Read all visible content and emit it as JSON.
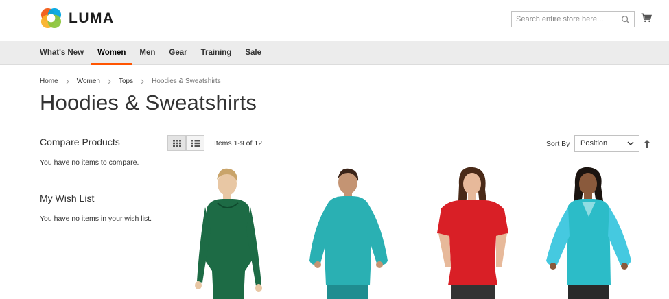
{
  "header": {
    "brand": "LUMA",
    "search_placeholder": "Search entire store here...",
    "logo_colors": [
      "#f26322",
      "#f9b22a",
      "#8dc63f",
      "#00a6e2"
    ]
  },
  "nav": {
    "items": [
      {
        "label": "What's New",
        "active": false
      },
      {
        "label": "Women",
        "active": true
      },
      {
        "label": "Men",
        "active": false
      },
      {
        "label": "Gear",
        "active": false
      },
      {
        "label": "Training",
        "active": false
      },
      {
        "label": "Sale",
        "active": false
      }
    ],
    "active_color": "#ff5501"
  },
  "breadcrumb": [
    "Home",
    "Women",
    "Tops",
    "Hoodies & Sweatshirts"
  ],
  "page_title": "Hoodies & Sweatshirts",
  "sidebar": {
    "compare_title": "Compare Products",
    "compare_text": "You have no items to compare.",
    "wishlist_title": "My Wish List",
    "wishlist_text": "You have no items in your wish list."
  },
  "toolbar": {
    "items_count": "Items 1-9 of 12",
    "sort_label": "Sort By",
    "sort_value": "Position",
    "view_modes": [
      "grid-icon",
      "list-icon"
    ]
  },
  "products": [
    {
      "icon": "product-image-green-hoodie",
      "color": "#1d6b45"
    },
    {
      "icon": "product-image-teal-hoodie",
      "color": "#2ab0b3"
    },
    {
      "icon": "product-image-red-top",
      "color": "#d91f26"
    },
    {
      "icon": "product-image-cyan-sweatshirt",
      "color": "#2cbcc8"
    }
  ]
}
